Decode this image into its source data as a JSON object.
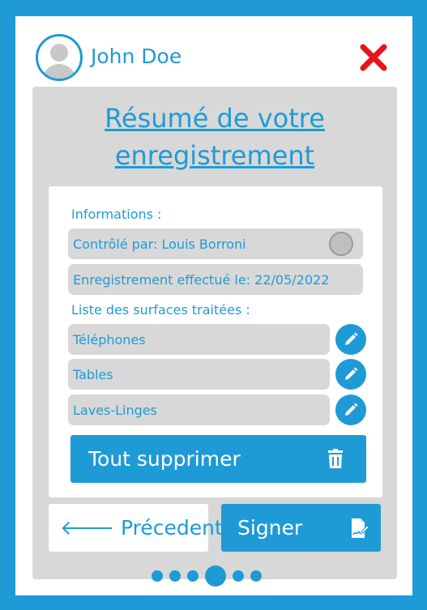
{
  "header": {
    "username": "John Doe"
  },
  "title_line1": "Résumé de votre",
  "title_line2": "enregistrement ",
  "card": {
    "info_label": "Informations :",
    "controlled_by": "Contrôlé par: Louis Borroni",
    "recorded_on": "Enregistrement effectué le: 22/05/2022",
    "surfaces_label": "Liste des surfaces traitées :",
    "surfaces": [
      "Téléphones",
      "Tables",
      "Laves-Linges"
    ],
    "delete_all_label": "Tout supprimer"
  },
  "nav": {
    "previous_label": "Précedent",
    "sign_label": "Signer",
    "page_count": 6,
    "current_page": 4
  },
  "colors": {
    "accent": "#1e9bd6",
    "panel": "#d8d8d8",
    "close": "#e8131b"
  },
  "icons": {
    "close": "close-icon",
    "edit": "pencil-icon",
    "delete": "trash-icon",
    "back": "arrow-left-icon",
    "sign": "signature-icon"
  }
}
